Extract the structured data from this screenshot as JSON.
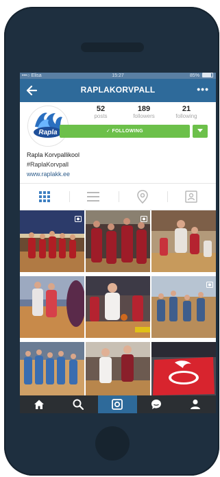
{
  "status_bar": {
    "carrier": "•••○ Elisa",
    "time": "15:27",
    "battery": "85%",
    "battery_level": 0.85
  },
  "nav": {
    "title": "RAPLAKORVPALL",
    "more": "•••"
  },
  "avatar": {
    "logo_text": "Rapla"
  },
  "stats": {
    "posts": {
      "value": "52",
      "label": "posts"
    },
    "followers": {
      "value": "189",
      "label": "followers"
    },
    "following": {
      "value": "21",
      "label": "following"
    }
  },
  "follow_button": {
    "label": "✓ FOLLOWING",
    "color": "#6cc04a"
  },
  "bio": {
    "name": "Rapla Korvpallikool",
    "hashtag": "#RaplaKorvpall",
    "website": "www.raplakk.ee"
  },
  "view_tabs": [
    "grid-icon",
    "list-icon",
    "location-pin-icon",
    "tagged-photos-icon"
  ],
  "grid_tiles": [
    {
      "name": "team-huddle-photo",
      "video": true
    },
    {
      "name": "players-red-jerseys-photo",
      "video": true
    },
    {
      "name": "game-action-photo",
      "video": false
    },
    {
      "name": "coach-sideline-photo",
      "video": false
    },
    {
      "name": "player-dribbling-photo",
      "video": false
    },
    {
      "name": "youth-team-photo",
      "video": true
    },
    {
      "name": "youth-lineup-photo",
      "video": false
    },
    {
      "name": "layup-photo",
      "video": false
    },
    {
      "name": "rapla-banner-photo",
      "video": false
    }
  ],
  "colors": {
    "nav_bar": "#2e6a9a",
    "phone_body": "#1e2f3f",
    "tab_bar": "#2b2f33",
    "active_tab": "#2e6a9a"
  },
  "tab_bar": [
    "home-icon",
    "search-icon",
    "camera-icon",
    "activity-icon",
    "profile-icon"
  ]
}
